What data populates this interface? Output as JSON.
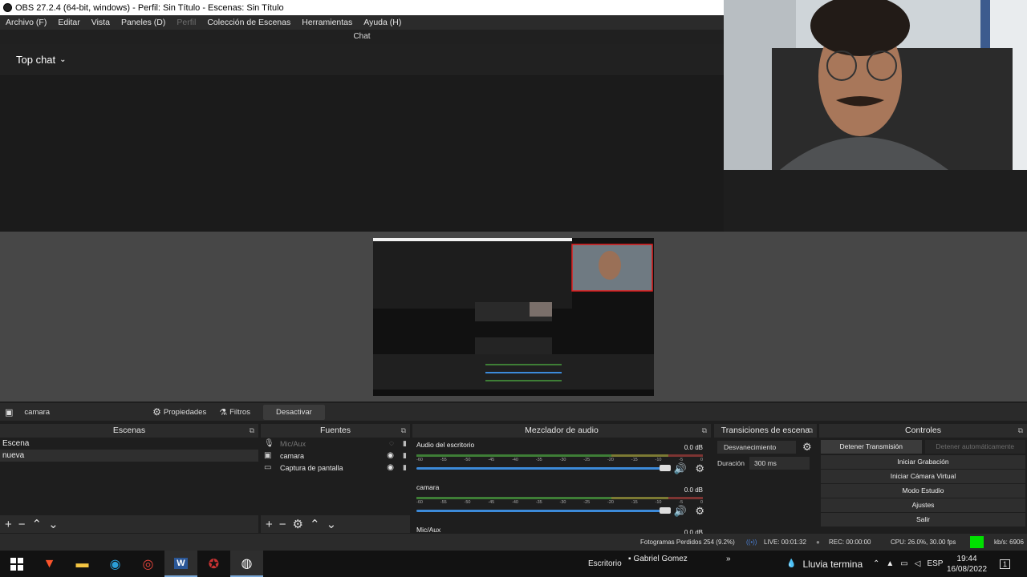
{
  "window": {
    "title": "OBS 27.2.4 (64-bit, windows) - Perfil: Sin Título - Escenas: Sin Título"
  },
  "menu": [
    "Archivo (F)",
    "Editar",
    "Vista",
    "Paneles (D)",
    "Perfil",
    "Colección de Escenas",
    "Herramientas",
    "Ayuda (H)"
  ],
  "chat": {
    "header": "Chat",
    "mode": "Top chat"
  },
  "source_toolbar": {
    "current_source": "camara",
    "properties": "Propiedades",
    "filters": "Filtros",
    "deactivate": "Desactivar"
  },
  "scenes": {
    "title": "Escenas",
    "items": [
      "Escena",
      "nueva"
    ]
  },
  "sources": {
    "title": "Fuentes",
    "items": [
      {
        "name": "Mic/Aux",
        "icon": "mic-icon",
        "hidden": true
      },
      {
        "name": "camara",
        "icon": "camera-icon",
        "hidden": false
      },
      {
        "name": "Captura de pantalla",
        "icon": "monitor-icon",
        "hidden": false
      }
    ]
  },
  "mixer": {
    "title": "Mezclador de audio",
    "channels": [
      {
        "name": "Audio del escritorio",
        "db": "0.0 dB"
      },
      {
        "name": "camara",
        "db": "0.0 dB"
      },
      {
        "name": "Mic/Aux",
        "db": "0.0 dB"
      }
    ],
    "ticks": [
      "-60",
      "-55",
      "-50",
      "-45",
      "-40",
      "-35",
      "-30",
      "-25",
      "-20",
      "-15",
      "-10",
      "-5",
      "0"
    ]
  },
  "transitions": {
    "title": "Transiciones de escena",
    "selected": "Desvanecimiento",
    "duration_label": "Duración",
    "duration": "300 ms"
  },
  "controls": {
    "title": "Controles",
    "stop_stream": "Detener Transmisión",
    "auto_stop": "Detener automáticamente",
    "record": "Iniciar Grabación",
    "virtual_cam": "Iniciar Cámara Virtual",
    "studio": "Modo Estudio",
    "settings": "Ajustes",
    "exit": "Salir"
  },
  "status": {
    "dropped": "Fotogramas Perdidos 254 (9.2%)",
    "live": "LIVE: 00:01:32",
    "rec": "REC: 00:00:00",
    "cpu": "CPU: 26.0%, 30.00 fps",
    "kbs": "kb/s: 6906",
    "status_color": "#00e000"
  },
  "taskbar": {
    "desktop": "Escritorio",
    "user": "Gabriel Gomez",
    "weather": "Lluvia termina",
    "lang": "ESP",
    "time": "19:44",
    "date": "16/08/2022"
  }
}
